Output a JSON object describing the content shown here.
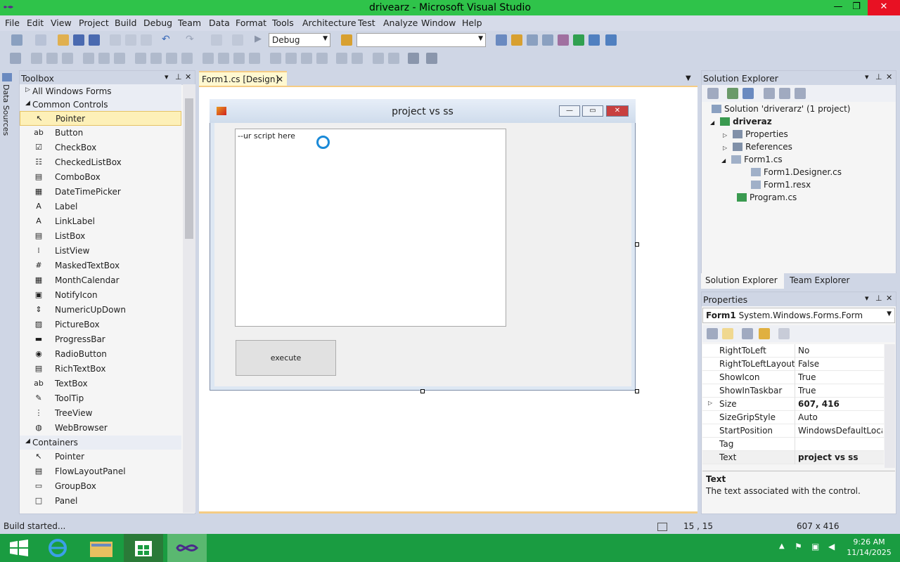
{
  "window": {
    "title": "drivearz - Microsoft Visual Studio",
    "minimize": "—",
    "maximize": "❐",
    "close": "✕"
  },
  "menu": [
    "File",
    "Edit",
    "View",
    "Project",
    "Build",
    "Debug",
    "Team",
    "Data",
    "Format",
    "Tools",
    "Architecture",
    "Test",
    "Analyze",
    "Window",
    "Help"
  ],
  "toolbar": {
    "config": "Debug",
    "platform": ""
  },
  "side_strip": {
    "label": "Data Sources"
  },
  "toolbox": {
    "title": "Toolbox",
    "all_windows_forms": "All Windows Forms",
    "common_controls": "Common Controls",
    "items": [
      "Pointer",
      "Button",
      "CheckBox",
      "CheckedListBox",
      "ComboBox",
      "DateTimePicker",
      "Label",
      "LinkLabel",
      "ListBox",
      "ListView",
      "MaskedTextBox",
      "MonthCalendar",
      "NotifyIcon",
      "NumericUpDown",
      "PictureBox",
      "ProgressBar",
      "RadioButton",
      "RichTextBox",
      "TextBox",
      "ToolTip",
      "TreeView",
      "WebBrowser"
    ],
    "containers": "Containers",
    "container_items": [
      "Pointer",
      "FlowLayoutPanel",
      "GroupBox",
      "Panel"
    ]
  },
  "document": {
    "tab_label": "Form1.cs [Design]",
    "form_title": "project vs ss",
    "script_placeholder": "--ur script here",
    "execute_label": "execute"
  },
  "solution_explorer": {
    "title": "Solution Explorer",
    "solution": "Solution 'driverarz' (1 project)",
    "project": "driveraz",
    "nodes": [
      "Properties",
      "References",
      "Form1.cs",
      "Form1.Designer.cs",
      "Form1.resx",
      "Program.cs"
    ],
    "tab_solution": "Solution Explorer",
    "tab_team": "Team Explorer"
  },
  "properties": {
    "title": "Properties",
    "object_name": "Form1",
    "object_type": "System.Windows.Forms.Form",
    "rows": [
      {
        "name": "RightToLeft",
        "value": "No"
      },
      {
        "name": "RightToLeftLayout",
        "value": "False"
      },
      {
        "name": "ShowIcon",
        "value": "True"
      },
      {
        "name": "ShowInTaskbar",
        "value": "True"
      },
      {
        "name": "Size",
        "value": "607, 416"
      },
      {
        "name": "SizeGripStyle",
        "value": "Auto"
      },
      {
        "name": "StartPosition",
        "value": "WindowsDefaultLocation"
      },
      {
        "name": "Tag",
        "value": ""
      },
      {
        "name": "Text",
        "value": "project vs ss"
      }
    ],
    "desc_title": "Text",
    "desc_body": "The text associated with the control."
  },
  "status": {
    "message": "Build started...",
    "position": "15 , 15",
    "size": "607 x 416"
  },
  "taskbar": {
    "time": "9:26 AM",
    "date": "11/14/2025"
  },
  "colors": {
    "accent": "#2fc34a",
    "chrome": "#cfd6e5",
    "tab_highlight": "#f5cc84",
    "spinner": "#1a8ad8"
  }
}
